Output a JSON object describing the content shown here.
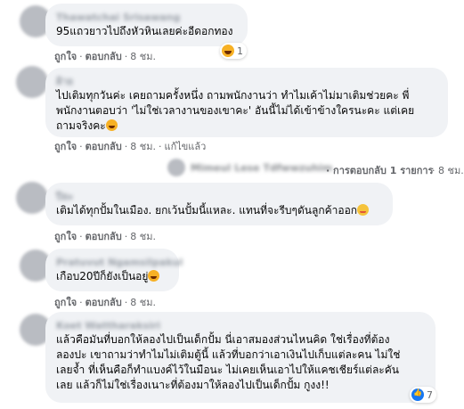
{
  "actions": {
    "like": "ถูกใจ",
    "reply": "ตอบกลับ",
    "edited": "แก้ไขแล้ว",
    "dot": "·"
  },
  "comments": [
    {
      "name": "Thawatchai Srisawang",
      "text_lines": [
        "95แถวยาวไปถึงหัวหินเลยค่ะอีดอกทอง"
      ],
      "time": "8 ชม.",
      "reaction": {
        "icon": "haha-emoji-icon",
        "count": "1"
      }
    },
    {
      "name": "ฝ้าย",
      "text_lines": [
        "ไปเติมทุกวันค่ะ เคยถามครั้งหนึ่ง ถามพนักงานว่า ทำไมเค้าไม่มาเติมช่วยคะ พี่",
        "พนักงานตอบว่า 'ไม่ใช่เวลางานของเขาคะ' อันนี้ไม่ได้เข้าข้างใครนะคะ แต่เคย",
        "ถามจริงคะ"
      ],
      "time": "8 ชม.",
      "edited": true
    },
    {
      "name": "ปิยะ",
      "text_lines": [
        "เติมได้ทุกปั้มในเมือง. ยกเว้นปั้มนี้แหละ. แทนที่จะรีบๆดันลูกค้าออก"
      ],
      "time": "8 ชม."
    },
    {
      "name": "Pratuvut Ngamsilpakul",
      "text_lines": [
        "เกือบ20ปีก็ยังเป็นอยู่"
      ],
      "time": "8 ชม."
    },
    {
      "name": "Koet Wattharaksiri",
      "text_lines": [
        "แล้วคือมันที่บอกให้ลองไปเป็นเด็กปั้ม นี่เอาสมองส่วนไหนคิด ใช่เรื่องที่ต้อง",
        "ลองปะ เขาถามว่าทำไมไม่เติมตู้นี้ แล้วที่บอกว่าเอาเงินไปเก็บแต่ละคน ไม่ใช่",
        "เลยจ้ำ ที่เห็นคือก็ทำแบงค์ไว้ในมือนะ ไม่เคยเห็นเอาไปให้แคชเชียร์แต่ละคัน",
        "เลย แล้วก็ไม่ใช่เรื่องเนาะที่ต้องมาให้ลองไปเป็นเด็กปั้ม กูงง!!"
      ],
      "time": "8 ชม.",
      "reaction": {
        "icon": "like-reaction-icon",
        "count": "7"
      }
    }
  ],
  "reply_thread": {
    "name": "Mimeul Lese Tdfwwzuhim",
    "label": "การตอบกลับ 1 รายการ",
    "time": "8 ชม."
  }
}
